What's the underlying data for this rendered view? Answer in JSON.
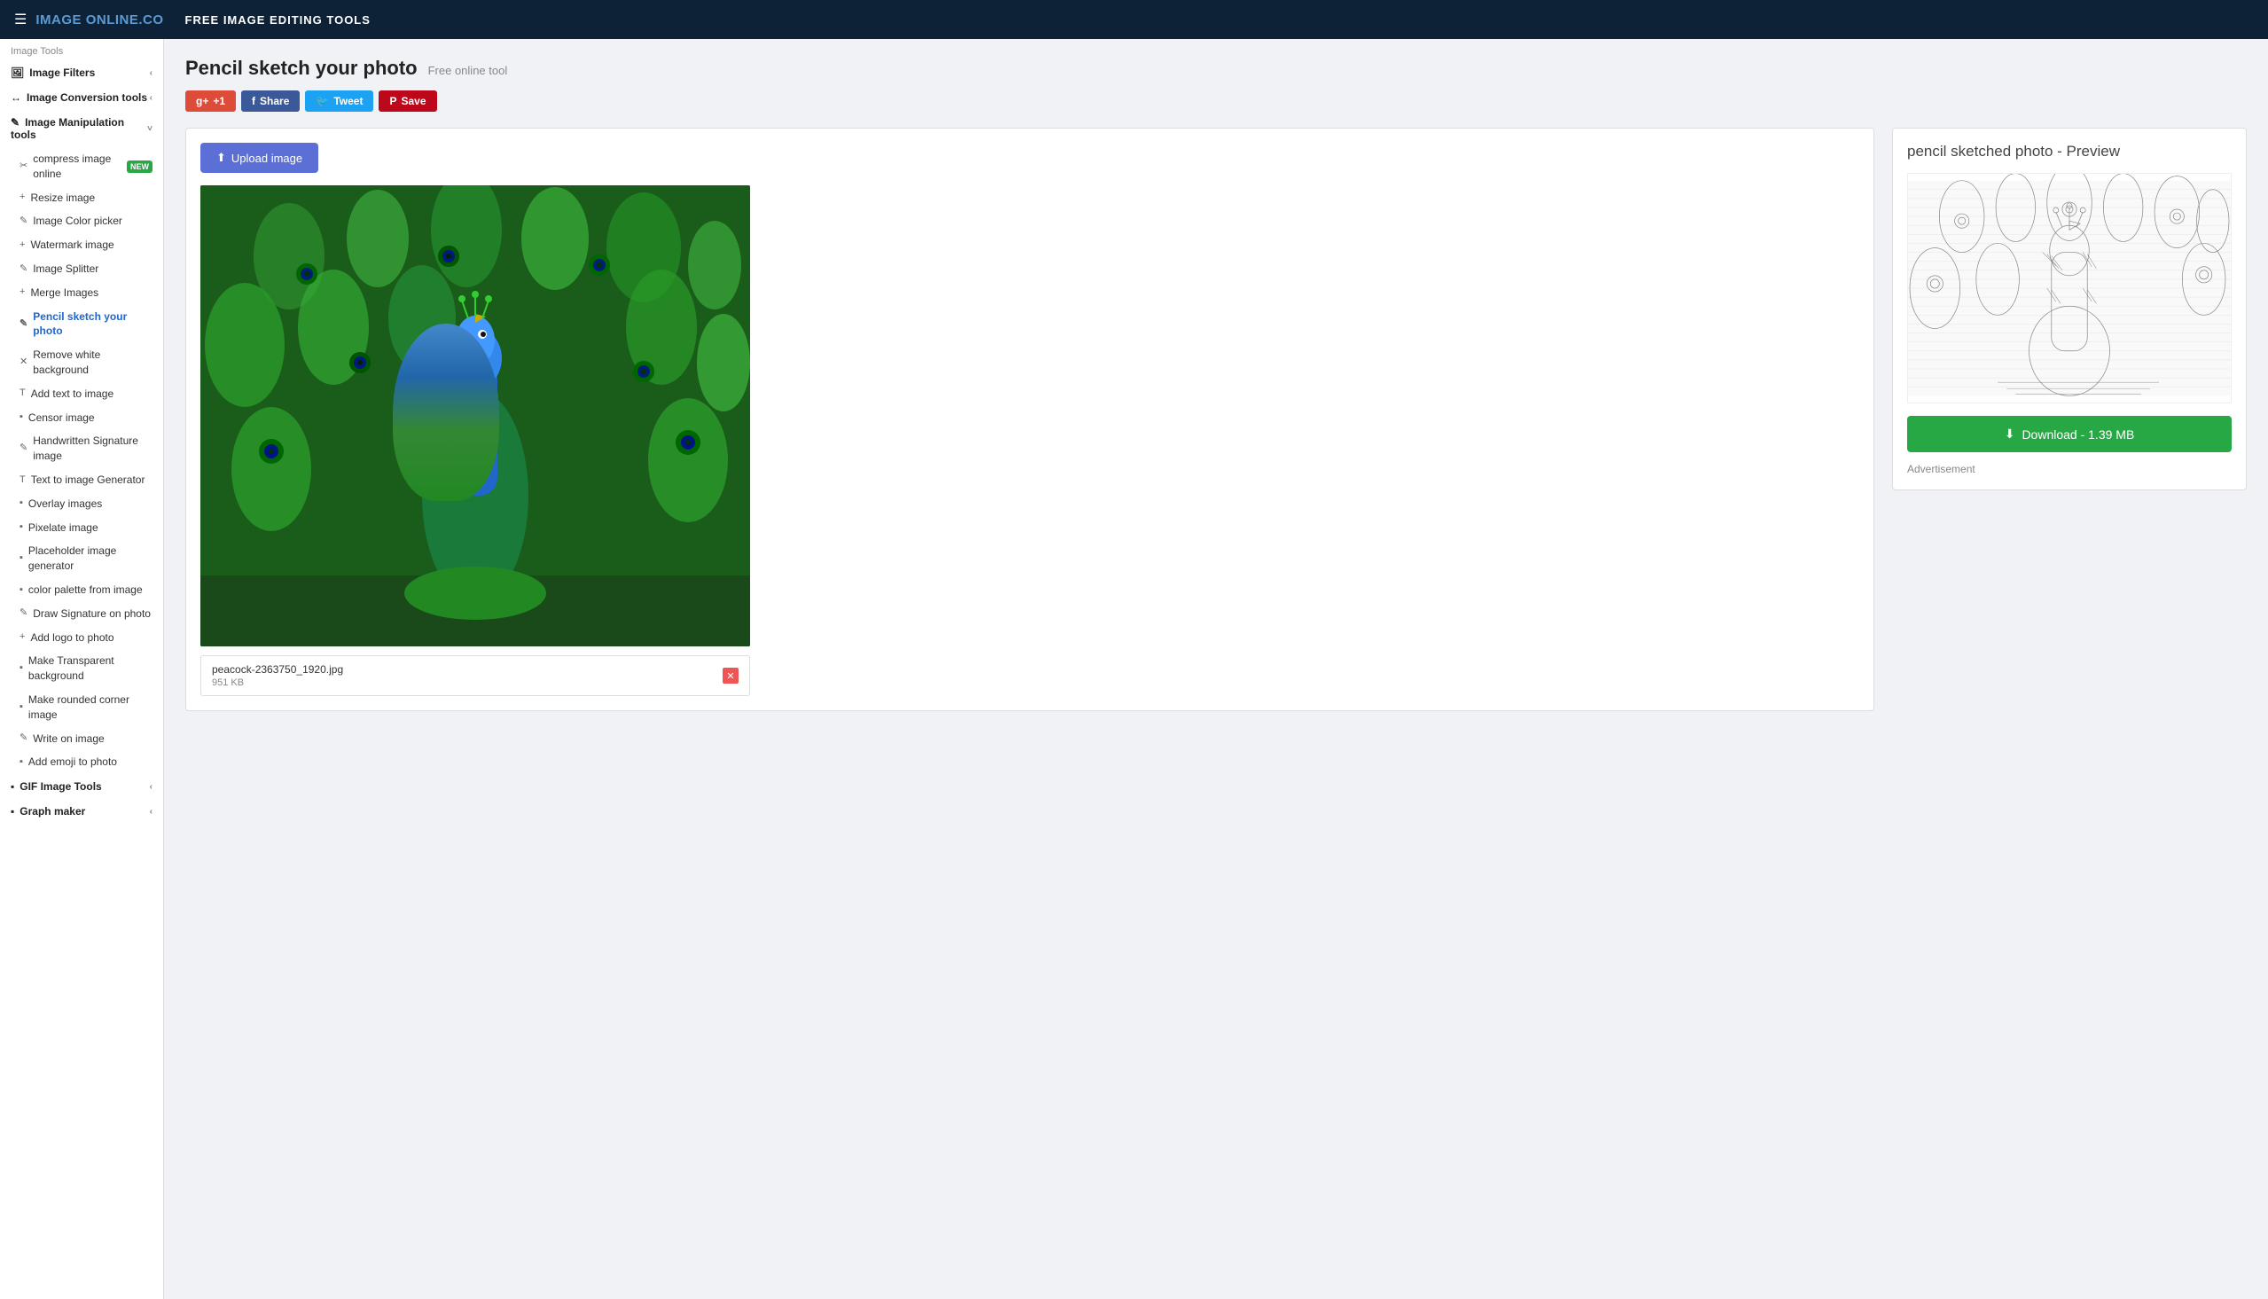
{
  "header": {
    "logo_text": "IMAGE",
    "logo_suffix": "ONLINE.CO",
    "menu_icon": "☰",
    "nav_title": "FREE IMAGE EDITING TOOLS"
  },
  "sidebar": {
    "section_label": "Image Tools",
    "groups": [
      {
        "id": "image-filters",
        "label": "Image Filters",
        "icon": "🖼",
        "chevron": "‹",
        "expanded": false,
        "items": []
      },
      {
        "id": "image-conversion",
        "label": "Image Conversion tools",
        "icon": "↔",
        "chevron": "‹",
        "expanded": false,
        "items": []
      },
      {
        "id": "image-manipulation",
        "label": "Image Manipulation tools",
        "icon": "✎",
        "chevron": "˅",
        "expanded": true,
        "items": [
          {
            "id": "compress-image",
            "label": "compress image online",
            "icon": "✂",
            "badge": "NEW",
            "active": false
          },
          {
            "id": "resize-image",
            "label": "Resize image",
            "icon": "+",
            "active": false
          },
          {
            "id": "image-color-picker",
            "label": "Image Color picker",
            "icon": "✎",
            "active": false
          },
          {
            "id": "watermark-image",
            "label": "Watermark image",
            "icon": "+",
            "active": false
          },
          {
            "id": "image-splitter",
            "label": "Image Splitter",
            "icon": "✎",
            "active": false
          },
          {
            "id": "merge-images",
            "label": "Merge Images",
            "icon": "+",
            "active": false
          },
          {
            "id": "pencil-sketch",
            "label": "Pencil sketch your photo",
            "icon": "✎",
            "active": true
          },
          {
            "id": "remove-white-bg",
            "label": "Remove white background",
            "icon": "✕",
            "active": false
          },
          {
            "id": "add-text",
            "label": "Add text to image",
            "icon": "T",
            "active": false
          },
          {
            "id": "censor-image",
            "label": "Censor image",
            "icon": "▪",
            "active": false
          },
          {
            "id": "handwritten-sig",
            "label": "Handwritten Signature image",
            "icon": "✎",
            "active": false
          },
          {
            "id": "text-to-image",
            "label": "Text to image Generator",
            "icon": "T",
            "active": false
          },
          {
            "id": "overlay-images",
            "label": "Overlay images",
            "icon": "▪",
            "active": false
          },
          {
            "id": "pixelate-image",
            "label": "Pixelate image",
            "icon": "▪",
            "active": false
          },
          {
            "id": "placeholder-gen",
            "label": "Placeholder image generator",
            "icon": "▪",
            "active": false
          },
          {
            "id": "color-palette",
            "label": "color palette from image",
            "icon": "▪",
            "active": false
          },
          {
            "id": "draw-signature",
            "label": "Draw Signature on photo",
            "icon": "✎",
            "active": false
          },
          {
            "id": "add-logo",
            "label": "Add logo to photo",
            "icon": "+",
            "active": false
          },
          {
            "id": "transparent-bg",
            "label": "Make Transparent background",
            "icon": "▪",
            "active": false
          },
          {
            "id": "rounded-corner",
            "label": "Make rounded corner image",
            "icon": "▪",
            "active": false
          },
          {
            "id": "write-on-image",
            "label": "Write on image",
            "icon": "✎",
            "active": false
          },
          {
            "id": "add-emoji",
            "label": "Add emoji to photo",
            "icon": "▪",
            "active": false
          }
        ]
      },
      {
        "id": "gif-tools",
        "label": "GIF Image Tools",
        "icon": "▪",
        "chevron": "‹",
        "expanded": false,
        "items": []
      },
      {
        "id": "graph-maker",
        "label": "Graph maker",
        "icon": "▪",
        "chevron": "‹",
        "expanded": false,
        "items": []
      }
    ]
  },
  "page": {
    "title": "Pencil sketch your photo",
    "subtitle": "Free online tool",
    "social_buttons": [
      {
        "id": "gplus",
        "label": "+1",
        "class": "btn-gplus"
      },
      {
        "id": "facebook",
        "label": "Share",
        "class": "btn-facebook"
      },
      {
        "id": "twitter",
        "label": "Tweet",
        "class": "btn-twitter"
      },
      {
        "id": "pinterest",
        "label": "Save",
        "class": "btn-pinterest"
      }
    ],
    "upload_button_label": "Upload image",
    "preview_title": "pencil sketched photo - Preview",
    "download_button_label": "Download - 1.39 MB",
    "ad_label": "Advertisement",
    "file_name": "peacock-2363750_1920.jpg",
    "file_size": "951 KB"
  }
}
